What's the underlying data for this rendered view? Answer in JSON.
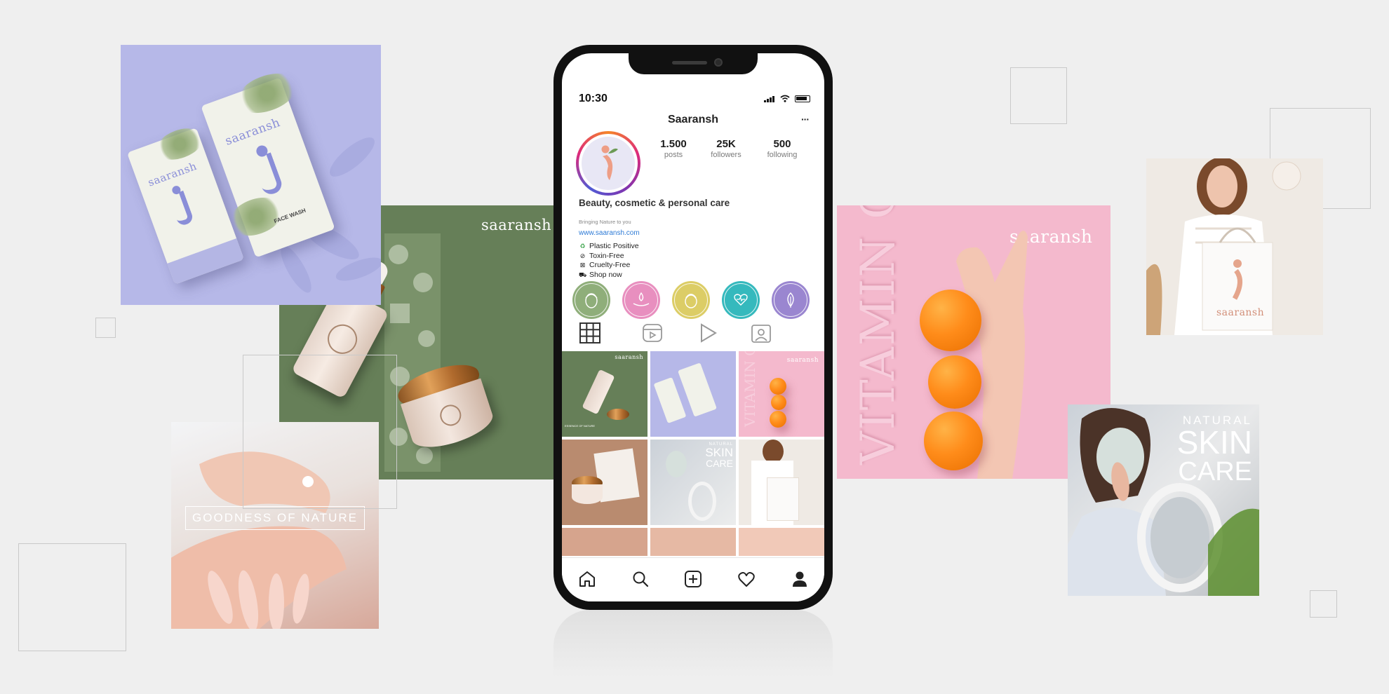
{
  "brand": "saaransh",
  "phone": {
    "status": {
      "time": "10:30"
    },
    "profile": {
      "name": "Saaransh",
      "more_label": "···",
      "stats": [
        {
          "value": "1.500",
          "label": "posts"
        },
        {
          "value": "25K",
          "label": "followers"
        },
        {
          "value": "500",
          "label": "following"
        }
      ],
      "bio_title": "Beauty, cosmetic & personal care",
      "bio_tagline": "Bringing Nature to you",
      "website": "www.saaransh.com",
      "bio_points": [
        {
          "icon": "recycle-icon",
          "glyph": "♻",
          "text": "Plastic Positive"
        },
        {
          "icon": "no-toxin-icon",
          "glyph": "⊘",
          "text": "Toxin-Free"
        },
        {
          "icon": "cruelty-free-icon",
          "glyph": "⊠",
          "text": "Cruelty-Free"
        },
        {
          "icon": "shop-icon",
          "glyph": "⛟",
          "text": "Shop now"
        }
      ],
      "highlights": [
        {
          "name": "face-care-icon",
          "color": "#8fae7a"
        },
        {
          "name": "hand-care-icon",
          "color": "#e88fbf"
        },
        {
          "name": "hair-care-icon",
          "color": "#dccd66"
        },
        {
          "name": "health-care-icon",
          "color": "#35b9bd"
        },
        {
          "name": "nature-icon",
          "color": "#9a86d0"
        }
      ],
      "tabs": [
        "grid-icon",
        "reels-icon",
        "video-icon",
        "tagged-icon"
      ]
    },
    "grid_posts": {
      "post_1_brand": "saaransh",
      "post_1_caption": "ESSENCE OF NATURE",
      "post_3_text": "VITAMIN C",
      "post_3_brand": "saaransh",
      "post_5_top": "NATURAL",
      "post_5_main1": "SKIN",
      "post_5_main2": "CARE"
    },
    "bottom_nav": [
      "home-icon",
      "search-icon",
      "add-post-icon",
      "heart-icon",
      "profile-icon"
    ]
  },
  "collage": {
    "tube_brand": "saaransh",
    "tube_label": "FACE WASH",
    "green_brand": "saaransh",
    "hands_caption": "GOODNESS OF NATURE",
    "pink_vertical": "VITAMIN C",
    "pink_brand": "saaransh",
    "bag_brand": "saaransh",
    "mask_top": "NATURAL",
    "mask_main1": "SKIN",
    "mask_main2": "CARE"
  },
  "colors": {
    "lavender": "#b6b8e8",
    "sage": "#667f58",
    "pink": "#f4b9cd",
    "link": "#2e7bd6"
  }
}
